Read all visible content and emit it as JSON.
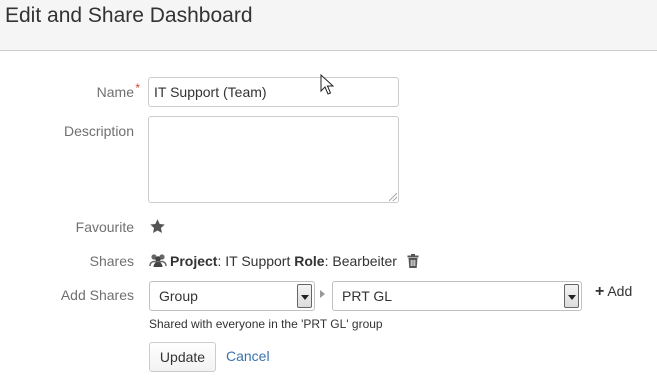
{
  "header": {
    "title": "Edit and Share Dashboard"
  },
  "form": {
    "name_label": "Name",
    "required_mark": "*",
    "name_value": "IT Support (Team)",
    "description_label": "Description",
    "description_value": "",
    "favourite_label": "Favourite",
    "shares_label": "Shares",
    "share": {
      "project_label": "Project",
      "project_value": ": IT Support ",
      "role_label": "Role",
      "role_value": ": Bearbeiter"
    },
    "add_shares_label": "Add Shares",
    "share_type_selected": "Group",
    "group_selected": "PRT GL",
    "add_label": "Add",
    "hint": "Shared with everyone in the 'PRT GL' group",
    "update_label": "Update",
    "cancel_label": "Cancel"
  },
  "icons": {
    "favourite": "star-icon",
    "share_type": "group-icon",
    "delete": "trash-icon",
    "add": "plus-icon"
  },
  "colors": {
    "header_bg": "#f5f5f5",
    "required": "#d04437",
    "link": "#3b73af",
    "label": "#707070"
  }
}
